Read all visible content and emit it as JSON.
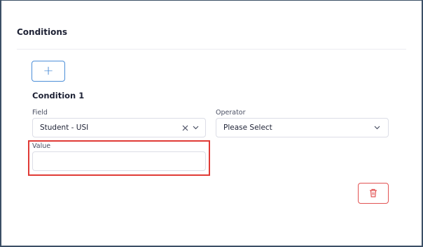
{
  "section": {
    "title": "Conditions"
  },
  "add_button": {
    "label": "+"
  },
  "condition": {
    "title": "Condition 1",
    "field": {
      "label": "Field",
      "value": "Student - USI",
      "clear_icon": "✕",
      "chevron_icon": "⌄"
    },
    "operator": {
      "label": "Operator",
      "value": "Please Select",
      "chevron_icon": "⌄"
    },
    "value": {
      "label": "Value",
      "current": ""
    }
  },
  "colors": {
    "accent": "#3f85d4",
    "highlight": "#e03a35",
    "danger": "#e25252"
  },
  "icons": {
    "add": "plus-icon",
    "delete": "trash-icon",
    "clear": "close-icon",
    "dropdown": "chevron-down-icon"
  }
}
